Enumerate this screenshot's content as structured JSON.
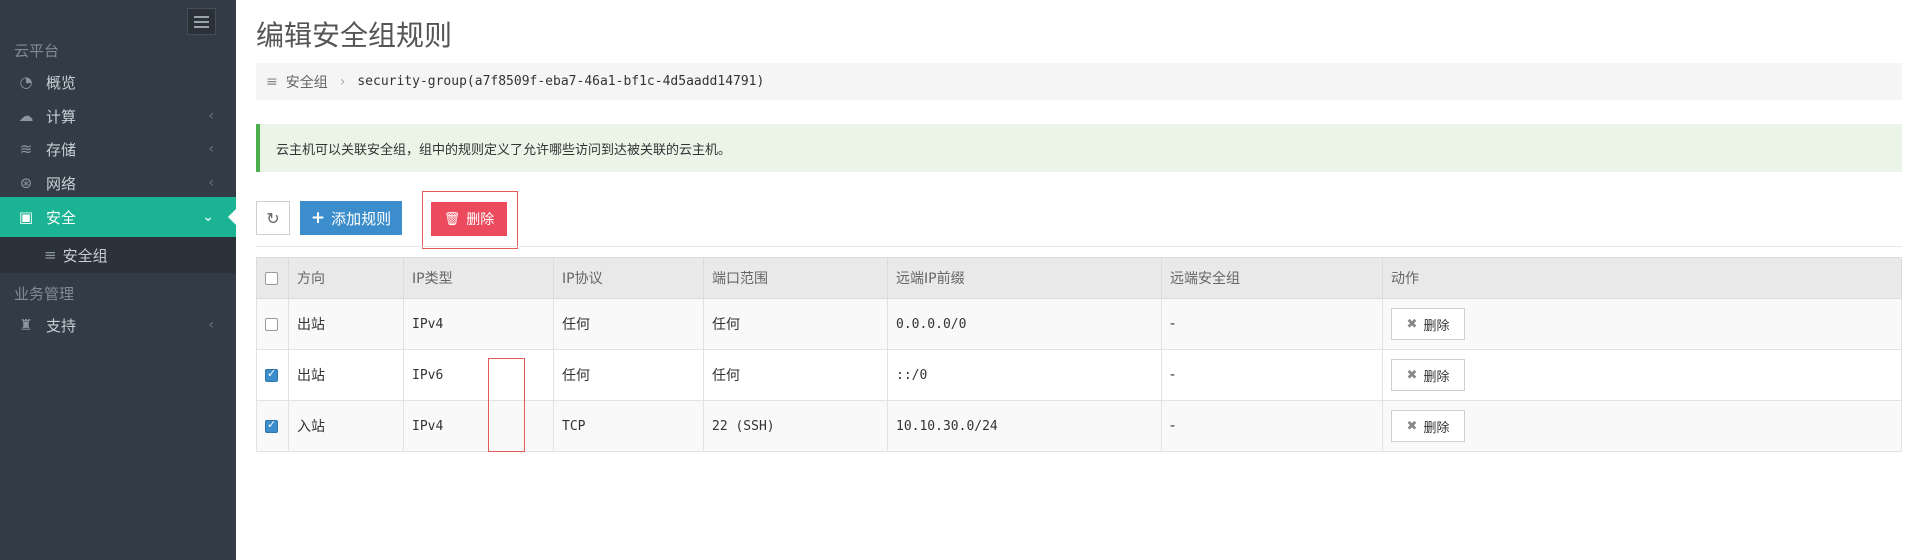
{
  "sidebar": {
    "section_cloud": "云平台",
    "items": [
      {
        "label": "概览",
        "icon": "dashboard-icon"
      },
      {
        "label": "计算",
        "icon": "cloud-icon"
      },
      {
        "label": "存储",
        "icon": "database-icon"
      },
      {
        "label": "网络",
        "icon": "network-icon"
      },
      {
        "label": "安全",
        "icon": "briefcase-icon"
      }
    ],
    "sub_item": {
      "label": "安全组",
      "icon": "list-icon"
    },
    "section_business": "业务管理",
    "support": {
      "label": "支持",
      "icon": "support-icon"
    },
    "accent_color": "#1ab394",
    "background_color": "#333c46"
  },
  "page": {
    "title": "编辑安全组规则",
    "breadcrumb": {
      "root": "安全组",
      "current": "security-group(a7f8509f-eba7-46a1-bf1c-4d5aadd14791)"
    },
    "alert": "云主机可以关联安全组，组中的规则定义了允许哪些访问到达被关联的云主机。"
  },
  "toolbar": {
    "add_label": "添加规则",
    "delete_label": "删除",
    "add_color": "#3c8dcb",
    "delete_color": "#ec4b5d"
  },
  "table": {
    "headers": [
      "方向",
      "IP类型",
      "IP协议",
      "端口范围",
      "远端IP前缀",
      "远端安全组",
      "动作"
    ],
    "rows": [
      {
        "checked": false,
        "direction": "出站",
        "ip_type": "IPv4",
        "protocol": "任何",
        "port_range": "任何",
        "remote_ip": "0.0.0.0/0",
        "remote_group": "-",
        "action": "删除"
      },
      {
        "checked": true,
        "direction": "出站",
        "ip_type": "IPv6",
        "protocol": "任何",
        "port_range": "任何",
        "remote_ip": "::/0",
        "remote_group": "-",
        "action": "删除"
      },
      {
        "checked": true,
        "direction": "入站",
        "ip_type": "IPv4",
        "protocol": "TCP",
        "port_range": "22 (SSH)",
        "remote_ip": "10.10.30.0/24",
        "remote_group": "-",
        "action": "删除"
      }
    ]
  }
}
